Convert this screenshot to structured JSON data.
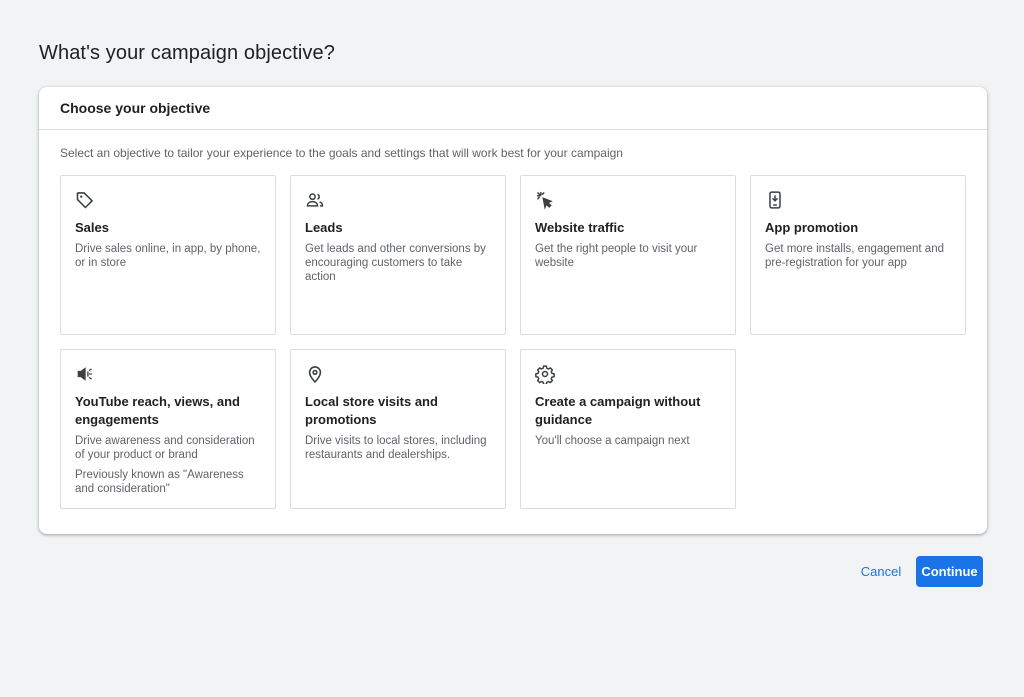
{
  "page": {
    "title": "What's your campaign objective?"
  },
  "card": {
    "heading": "Choose your objective",
    "subtitle": "Select an objective to tailor your experience to the goals and settings that will work best for your campaign"
  },
  "objectives": [
    {
      "icon": "tag-icon",
      "title": "Sales",
      "description": "Drive sales online, in app, by phone, or in store"
    },
    {
      "icon": "people-icon",
      "title": "Leads",
      "description": "Get leads and other conversions by encouraging customers to take action"
    },
    {
      "icon": "cursor-click-icon",
      "title": "Website traffic",
      "description": "Get the right people to visit your website"
    },
    {
      "icon": "phone-download-icon",
      "title": "App promotion",
      "description": "Get more installs, engagement and pre-registration for your app"
    },
    {
      "icon": "megaphone-icon",
      "title": "YouTube reach, views, and engagements",
      "description": "Drive awareness and consideration of your product or brand",
      "note": "Previously known as \"Awareness and consideration\""
    },
    {
      "icon": "location-pin-icon",
      "title": "Local store visits and promotions",
      "description": "Drive visits to local stores, including restaurants and dealerships."
    },
    {
      "icon": "gear-icon",
      "title": "Create a campaign without guidance",
      "description": "You'll choose a campaign next"
    }
  ],
  "actions": {
    "cancel_label": "Cancel",
    "continue_label": "Continue"
  },
  "colors": {
    "accent": "#1a73e8",
    "background": "#f1f3f4",
    "border": "#dadce0"
  }
}
